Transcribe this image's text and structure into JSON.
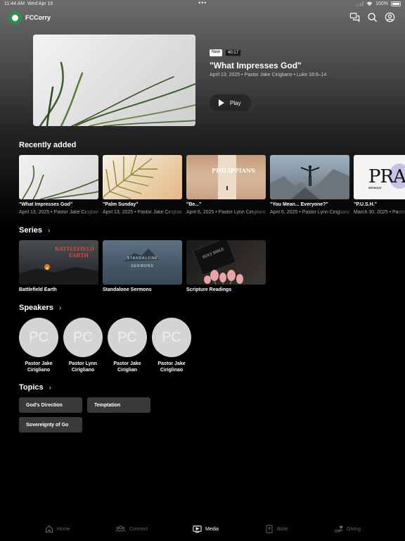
{
  "status_bar": {
    "time": "11:44 AM",
    "date": "Wed Apr 16",
    "battery": "100%"
  },
  "app": {
    "name": "FCCorry",
    "brand_color": "#2f8d4e"
  },
  "header_icons": [
    "chat-icon",
    "search-icon",
    "account-icon"
  ],
  "hero": {
    "badge_new": "New",
    "duration": "40:17",
    "title": "\"What Impresses God\"",
    "meta": "April 13, 2025 • Pastor Jake Cirigliano • Luke 18:9–14",
    "play_label": "Play"
  },
  "recently_added": {
    "title": "Recently added",
    "items": [
      {
        "title": "\"What Impresses God\"",
        "meta": "April 13, 2025 • Pastor Jake Ci",
        "meta_fade": "rigliano"
      },
      {
        "title": "\"Palm Sunday\"",
        "meta": "April 13, 2025 • Pastor Jake Ci",
        "meta_fade": "rigliano"
      },
      {
        "title": "\"Be...\"",
        "meta": "April 6, 2025 • Pastor Lynn Ciri",
        "meta_fade": "gliano"
      },
      {
        "title": "\"You Mean... Everyone?\"",
        "meta": "April 6, 2025 • Pastor Lynn Cirig",
        "meta_fade": "liano"
      },
      {
        "title": "\"P.U.S.H.\"",
        "meta": "March 30, 2025 • Pa",
        "meta_fade": "stor"
      }
    ],
    "thumb_texts": {
      "philippians": "PHILIPPIANS",
      "pray": "PRA",
      "pray_sub": "WITHOUT"
    }
  },
  "series": {
    "title": "Series",
    "items": [
      {
        "name": "Battlefield Earth",
        "art_line1": "BATTLEFIELD",
        "art_line2": "EARTH"
      },
      {
        "name": "Standalone Sermons",
        "art_line1": "STANDALONE",
        "art_line2": "SERMONS"
      },
      {
        "name": "Scripture Readings",
        "art_line1": "HOLY BIBLE",
        "art_line2": ""
      }
    ]
  },
  "speakers": {
    "title": "Speakers",
    "items": [
      {
        "initials": "PC",
        "line1": "Pastor Jake",
        "line2": "Cirigliano"
      },
      {
        "initials": "PC",
        "line1": "Pastor Lynn",
        "line2": "Cirigliano"
      },
      {
        "initials": "PC",
        "line1": "Pastor Jake",
        "line2": "Ciriglian"
      },
      {
        "initials": "PC",
        "line1": "Pastor Jake",
        "line2": "Ciriglinao"
      }
    ]
  },
  "topics": {
    "title": "Topics",
    "items": [
      "God's Direction",
      "Temptation",
      "Sovereignty of Go"
    ]
  },
  "tabs": [
    {
      "label": "Home",
      "icon": "home-icon",
      "active": false
    },
    {
      "label": "Connect",
      "icon": "people-icon",
      "active": false
    },
    {
      "label": "Media",
      "icon": "play-screen-icon",
      "active": true
    },
    {
      "label": "Bible",
      "icon": "bible-icon",
      "active": false
    },
    {
      "label": "Giving",
      "icon": "hand-heart-icon",
      "active": false
    }
  ]
}
